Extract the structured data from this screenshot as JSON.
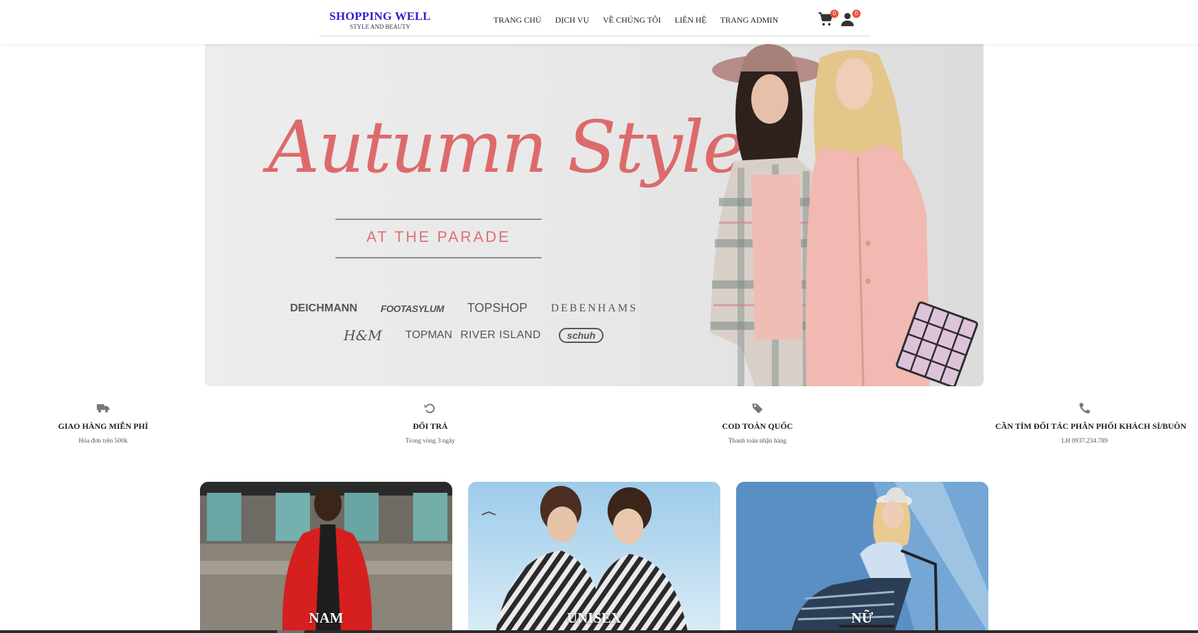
{
  "header": {
    "logo_title": "SHOPPING WELL",
    "logo_subtitle": "STYLE AND BEAUTY",
    "nav": [
      "TRANG CHỦ",
      "DỊCH VỤ",
      "VỀ CHÚNG TÔI",
      "LIÊN HỆ",
      "TRANG ADMIN"
    ],
    "cart_icon": "cart-icon",
    "cart_count": "0",
    "user_icon": "user-icon",
    "user_count": "0",
    "badge_color": "#ef4d3c",
    "logo_color": "#2d1fd0"
  },
  "hero": {
    "title": "Autumn Style",
    "subtitle": "AT THE PARADE",
    "brands_row1": [
      "DEICHMANN",
      "FOOTASYLUM",
      "TOPSHOP",
      "DEBENHAMS"
    ],
    "brands_row2": [
      "H&M",
      "TOPMAN",
      "RIVER ISLAND",
      "schuh"
    ],
    "accent_color": "#dd6a6a"
  },
  "features": [
    {
      "icon": "truck-icon",
      "title": "GIAO HÀNG MIỄN PHÍ",
      "desc": "Hóa đơn trên 500k"
    },
    {
      "icon": "return-icon",
      "title": "ĐỔI TRẢ",
      "desc": "Trong vòng 3 ngày"
    },
    {
      "icon": "tag-icon",
      "title": "COD TOÀN QUỐC",
      "desc": "Thanh toán nhận hàng"
    },
    {
      "icon": "phone-icon",
      "title": "CẦN TÌM ĐỐI TÁC PHÂN PHỐI KHÁCH SỈ/BUÔN",
      "desc": "LH 0937.234.789"
    }
  ],
  "categories": [
    {
      "label": "NAM"
    },
    {
      "label": "UNISEX"
    },
    {
      "label": "NỮ"
    }
  ]
}
